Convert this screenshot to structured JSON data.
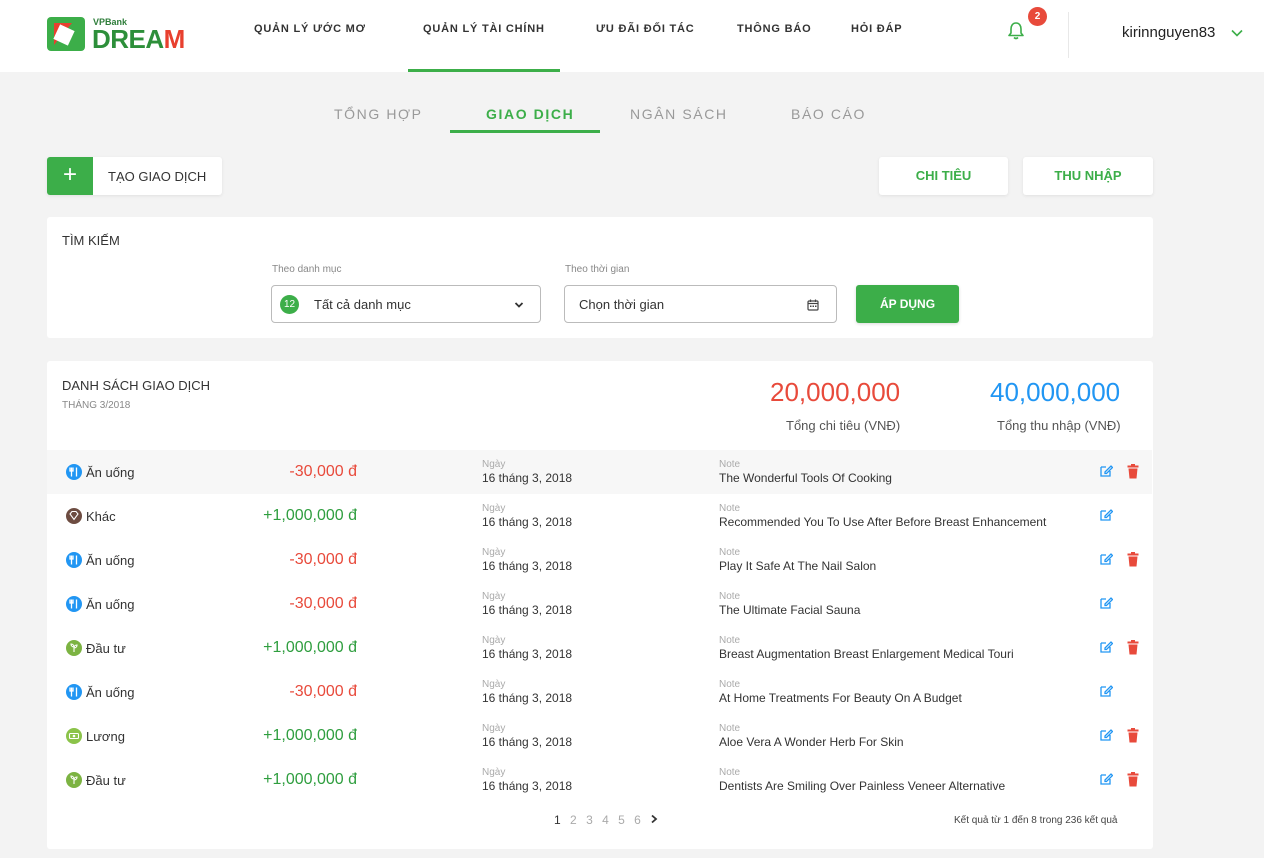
{
  "header": {
    "logo_small": "VPBank",
    "logo_big_a": "DREA",
    "logo_big_b": "M",
    "nav": [
      "QUẢN LÝ ƯỚC MƠ",
      "QUẢN LÝ TÀI CHÍNH",
      "ƯU ĐÃI ĐỐI TÁC",
      "THÔNG BÁO",
      "HỎI ĐÁP"
    ],
    "notification_count": "2",
    "username": "kirinnguyen83"
  },
  "tabs": [
    "TỔNG HỢP",
    "GIAO DỊCH",
    "NGÂN SÁCH",
    "BÁO CÁO"
  ],
  "actions": {
    "create_plus": "+",
    "create_label": "TẠO GIAO DỊCH",
    "expense": "CHI TIÊU",
    "income": "THU NHẬP"
  },
  "search": {
    "title": "TÌM KIẾM",
    "category_label": "Theo danh mục",
    "category_count": "12",
    "category_value": "Tất cả danh mục",
    "time_label": "Theo thời gian",
    "time_placeholder": "Chọn thời gian",
    "apply": "ÁP DỤNG"
  },
  "list": {
    "title": "DANH SÁCH GIAO DỊCH",
    "month": "THÁNG 3/2018",
    "total_expense": "20,000,000",
    "total_expense_label": "Tổng chi tiêu (VNĐ)",
    "total_income": "40,000,000",
    "total_income_label": "Tổng thu nhập (VNĐ)",
    "date_label": "Ngày",
    "note_label": "Note",
    "rows": [
      {
        "cat": "Ăn uống",
        "amount": "-30,000 đ",
        "date": "16 tháng 3, 2018",
        "note": "The Wonderful Tools Of Cooking"
      },
      {
        "cat": "Khác",
        "amount": "+1,000,000 đ",
        "date": "16 tháng 3, 2018",
        "note": "Recommended You To Use After Before Breast Enhancement"
      },
      {
        "cat": "Ăn uống",
        "amount": "-30,000 đ",
        "date": "16 tháng 3, 2018",
        "note": "Play It Safe At The Nail Salon"
      },
      {
        "cat": "Ăn uống",
        "amount": "-30,000 đ",
        "date": "16 tháng 3, 2018",
        "note": "The Ultimate Facial Sauna"
      },
      {
        "cat": "Đầu tư",
        "amount": "+1,000,000 đ",
        "date": "16 tháng 3, 2018",
        "note": "Breast Augmentation Breast Enlargement Medical Touri"
      },
      {
        "cat": "Ăn uống",
        "amount": "-30,000 đ",
        "date": "16 tháng 3, 2018",
        "note": "At Home Treatments For Beauty On A Budget"
      },
      {
        "cat": "Lương",
        "amount": "+1,000,000 đ",
        "date": "16 tháng 3, 2018",
        "note": "Aloe Vera A Wonder Herb For Skin"
      },
      {
        "cat": "Đầu tư",
        "amount": "+1,000,000 đ",
        "date": "16 tháng 3, 2018",
        "note": "Dentists Are Smiling Over Painless Veneer Alternative"
      }
    ],
    "pages": [
      "1",
      "2",
      "3",
      "4",
      "5",
      "6"
    ],
    "result_text": "Kết quả từ 1 đến 8 trong 236 kết quả"
  },
  "colors": {
    "accent": "#3cae49",
    "expense": "#e84a3b",
    "income": "#2196f3"
  }
}
